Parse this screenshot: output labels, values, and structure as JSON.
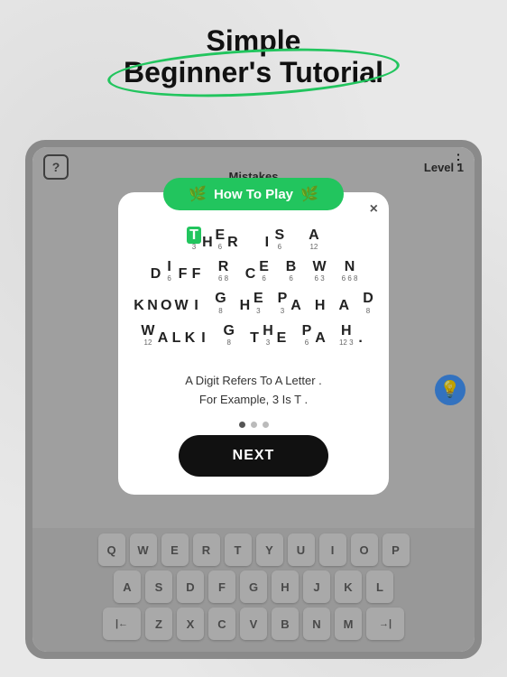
{
  "page": {
    "title_line1": "Simple",
    "title_line2": "Beginner's Tutorial"
  },
  "topbar": {
    "help_label": "?",
    "mistakes_label": "Mistakes",
    "level_label": "Level 1",
    "dots_menu": "⋮"
  },
  "modal": {
    "banner_text": "How To Play",
    "close_icon": "×",
    "puzzle_lines": [
      {
        "words": [
          {
            "letters": [
              "T",
              "H",
              "E",
              "R"
            ],
            "numbers": [
              3,
              "",
              "",
              ""
            ],
            "gap": true,
            "highlight_index": 0
          },
          {
            "letters": [
              "I",
              "S"
            ],
            "numbers": [
              "",
              ""
            ],
            "gap": true
          },
          {
            "letters": [
              "A"
            ],
            "numbers": [
              12
            ]
          }
        ]
      },
      {
        "words": [
          {
            "letters": [
              "D",
              "I",
              "F",
              "F"
            ],
            "numbers": [
              "",
              "6",
              "",
              ""
            ],
            "gap": true
          },
          {
            "letters": [
              "R"
            ],
            "numbers": [
              "6 8"
            ],
            "gap": true
          },
          {
            "letters": [
              "C",
              "E"
            ],
            "numbers": [
              "",
              "6"
            ],
            "gap": true
          },
          {
            "letters": [
              "B"
            ],
            "numbers": [
              "6"
            ],
            "gap": true
          },
          {
            "letters": [
              "W"
            ],
            "numbers": [
              6,
              3
            ],
            "gap": true
          },
          {
            "letters": [
              "N"
            ],
            "numbers": [
              "6 6 8"
            ]
          }
        ]
      },
      {
        "words": [
          {
            "letters": [
              "K",
              "N",
              "O",
              "W",
              "I"
            ],
            "numbers": [
              "",
              "",
              "",
              "",
              ""
            ],
            "gap": true
          },
          {
            "letters": [
              "G"
            ],
            "numbers": [
              8
            ],
            "gap": true
          },
          {
            "letters": [
              "H",
              "E"
            ],
            "numbers": [
              "",
              3
            ],
            "gap": true
          },
          {
            "letters": [
              "P",
              "A"
            ],
            "numbers": [
              3,
              ""
            ],
            "gap": true
          },
          {
            "letters": [
              "H"
            ],
            "numbers": [
              ""
            ],
            "gap": true
          },
          {
            "letters": [
              "A"
            ],
            "numbers": [
              ""
            ],
            "gap": true
          },
          {
            "letters": [
              "D"
            ],
            "numbers": [
              8
            ]
          }
        ]
      },
      {
        "words": [
          {
            "letters": [
              "W",
              "A",
              "L",
              "K",
              "I"
            ],
            "numbers": [
              12,
              "",
              "",
              "",
              ""
            ],
            "gap": true
          },
          {
            "letters": [
              "G"
            ],
            "numbers": [
              8
            ],
            "gap": true
          },
          {
            "letters": [
              "T",
              "H",
              "E"
            ],
            "numbers": [
              "",
              3,
              ""
            ],
            "gap": true
          },
          {
            "letters": [
              "P",
              "A"
            ],
            "numbers": [
              6,
              ""
            ],
            "gap": true
          },
          {
            "letters": [
              "H",
              "."
            ],
            "numbers": [
              "12 3",
              ""
            ]
          }
        ]
      }
    ],
    "info_text_line1": "A Digit Refers To A Letter  .",
    "info_text_line2": "For Example, 3 Is T .",
    "dots": [
      {
        "active": true
      },
      {
        "active": false
      },
      {
        "active": false
      }
    ],
    "next_button": "NEXT"
  },
  "keyboard": {
    "rows": [
      [
        "Q",
        "W",
        "E",
        "R",
        "T",
        "Y",
        "U",
        "I",
        "O",
        "P"
      ],
      [
        "A",
        "S",
        "D",
        "F",
        "G",
        "H",
        "J",
        "K",
        "L"
      ],
      [
        "Z",
        "X",
        "C",
        "V",
        "B",
        "N",
        "M"
      ]
    ],
    "special_keys": {
      "backspace": "⌫",
      "enter": "→|"
    }
  }
}
